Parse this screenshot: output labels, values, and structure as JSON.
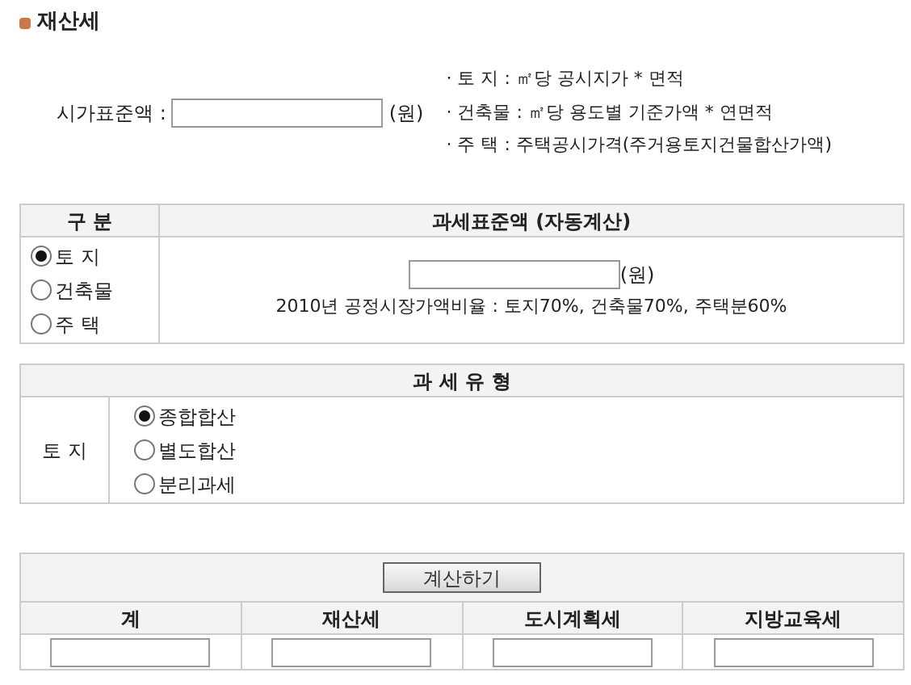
{
  "title": "재산세",
  "market_value": {
    "label": "시가표준액 :",
    "unit": "(원)",
    "notes": [
      "· 토 지 : ㎡당 공시지가 * 면적",
      "· 건축물 : ㎡당 용도별 기준가액 * 연면적",
      "· 주 택 : 주택공시가격(주거용토지건물합산가액)"
    ]
  },
  "base_table": {
    "headers": [
      "구 분",
      "과세표준액 (자동계산)"
    ],
    "options": [
      {
        "label": "토 지",
        "selected": true
      },
      {
        "label": "건축물",
        "selected": false
      },
      {
        "label": "주 택",
        "selected": false
      }
    ],
    "unit": "(원)",
    "note": "2010년 공정시장가액비율 : 토지70%, 건축물70%, 주택분60%"
  },
  "type_table": {
    "header": "과 세 유 형",
    "row_label": "토 지",
    "options": [
      {
        "label": "종합합산",
        "selected": true
      },
      {
        "label": "별도합산",
        "selected": false
      },
      {
        "label": "분리과세",
        "selected": false
      }
    ]
  },
  "result_table": {
    "button": "계산하기",
    "columns": [
      "계",
      "재산세",
      "도시계획세",
      "지방교육세"
    ]
  }
}
